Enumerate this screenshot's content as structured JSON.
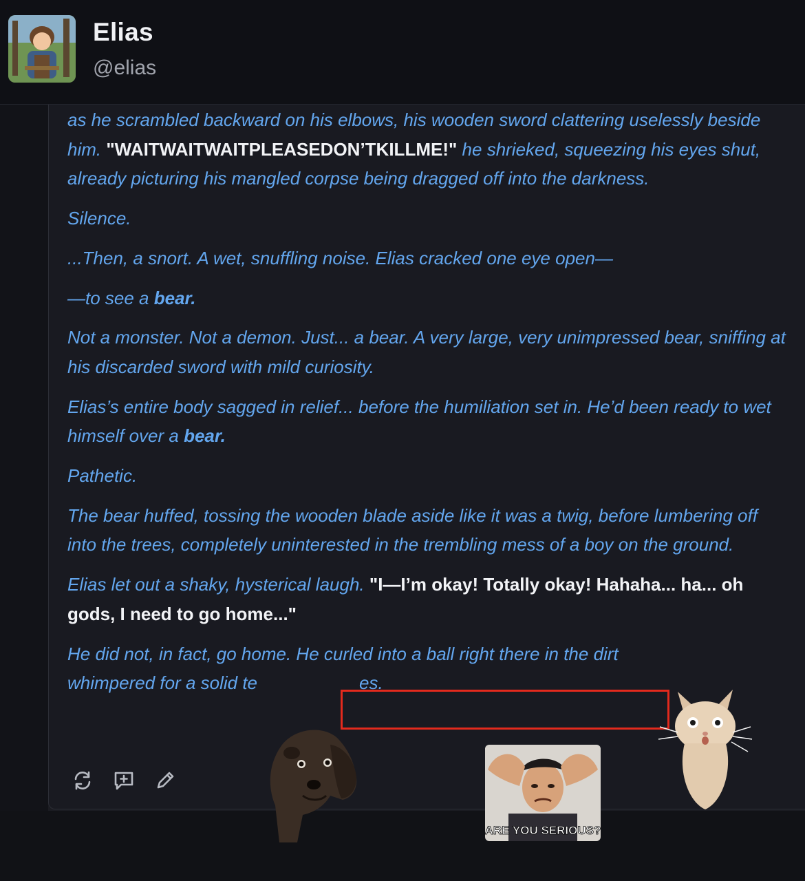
{
  "profile": {
    "name": "Elias",
    "handle": "@elias",
    "avatar_icon": "avatar-character-icon"
  },
  "message": {
    "p1_a": "as he scrambled backward on his elbows, his wooden sword clattering uselessly beside him.",
    "p1_dialog": "\"WAITWAITWAITPLEASEDON’TKILLME!\"",
    "p1_b": "he shrieked, squeezing his eyes shut, already picturing his mangled corpse being dragged off into the darkness.",
    "p2": "Silence.",
    "p3": "...Then, a snort. A wet, snuffling noise. Elias cracked one eye open—",
    "p4_a": "—to see a",
    "p4_em": "bear.",
    "p5": "Not a monster. Not a demon. Just... a bear. A very large, very unimpressed bear, sniffing at his discarded sword with mild curiosity.",
    "p6_a": "Elias’s entire body sagged in relief... before the humiliation set in. He’d been ready to wet himself over a",
    "p6_em": "bear.",
    "p7": "Pathetic.",
    "p8": "The bear huffed, tossing the wooden blade aside like it was a twig, before lumbering off into the trees, completely uninterested in the trembling mess of a boy on the ground.",
    "p9_a": "Elias let out a shaky, hysterical laugh.",
    "p9_dialog": "\"I—I’m okay! Totally okay! Hahaha... ha... oh gods, I need to go home...\"",
    "p10_a": "He did not, in fact, go home. He",
    "p10_b": "curled into a ball right there in the dirt",
    "p10_c": "whimpered for a solid te",
    "p10_d": "es."
  },
  "actions": [
    {
      "icon": "regenerate-icon"
    },
    {
      "icon": "new-branch-icon"
    },
    {
      "icon": "edit-pencil-icon"
    }
  ],
  "stickers": {
    "dog": "dog-sticker",
    "jackie": {
      "icon": "shocked-man-sticker",
      "caption": "ARE YOU SERIOUS?"
    },
    "cat": "cat-sticker"
  },
  "colors": {
    "narration": "#63a6ee",
    "dialog": "#f2f3f6",
    "highlight_box": "#e32a1d",
    "background": "#191a21"
  }
}
